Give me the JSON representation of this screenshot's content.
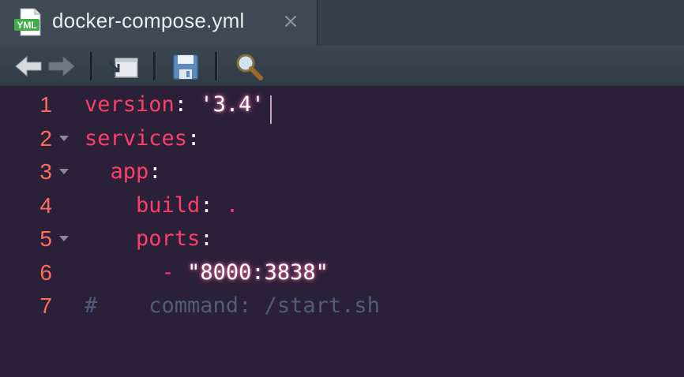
{
  "tab": {
    "title": "docker-compose.yml",
    "close_icon": "close-icon",
    "file_icon_label": "YML"
  },
  "toolbar": {
    "buttons": [
      "back-arrow-icon",
      "forward-arrow-icon",
      "show-in-window-icon",
      "save-icon",
      "search-icon"
    ]
  },
  "editor": {
    "lines": [
      {
        "num": "1",
        "fold": false,
        "tokens": [
          [
            "k",
            "version"
          ],
          [
            "p",
            ": "
          ],
          [
            "s",
            "'3.4'"
          ]
        ]
      },
      {
        "num": "2",
        "fold": true,
        "tokens": [
          [
            "k",
            "services"
          ],
          [
            "p",
            ":"
          ]
        ]
      },
      {
        "num": "3",
        "fold": true,
        "tokens": [
          [
            "p",
            "  "
          ],
          [
            "k",
            "app"
          ],
          [
            "p",
            ":"
          ]
        ]
      },
      {
        "num": "4",
        "fold": false,
        "tokens": [
          [
            "p",
            "    "
          ],
          [
            "k",
            "build"
          ],
          [
            "p",
            ": "
          ],
          [
            "d",
            "."
          ]
        ]
      },
      {
        "num": "5",
        "fold": true,
        "tokens": [
          [
            "p",
            "    "
          ],
          [
            "k",
            "ports"
          ],
          [
            "p",
            ":"
          ]
        ]
      },
      {
        "num": "6",
        "fold": false,
        "tokens": [
          [
            "p",
            "      "
          ],
          [
            "d",
            "-"
          ],
          [
            "p",
            " "
          ],
          [
            "s",
            "\"8000:3838\""
          ]
        ]
      },
      {
        "num": "7",
        "fold": false,
        "tokens": [
          [
            "c",
            "#    command: /start.sh"
          ]
        ]
      }
    ]
  },
  "colors": {
    "background": "#2a2139",
    "line_number": "#ff6b5b",
    "keyword": "#fe3d6b",
    "string": "#ffffff",
    "comment": "#525c7a"
  }
}
